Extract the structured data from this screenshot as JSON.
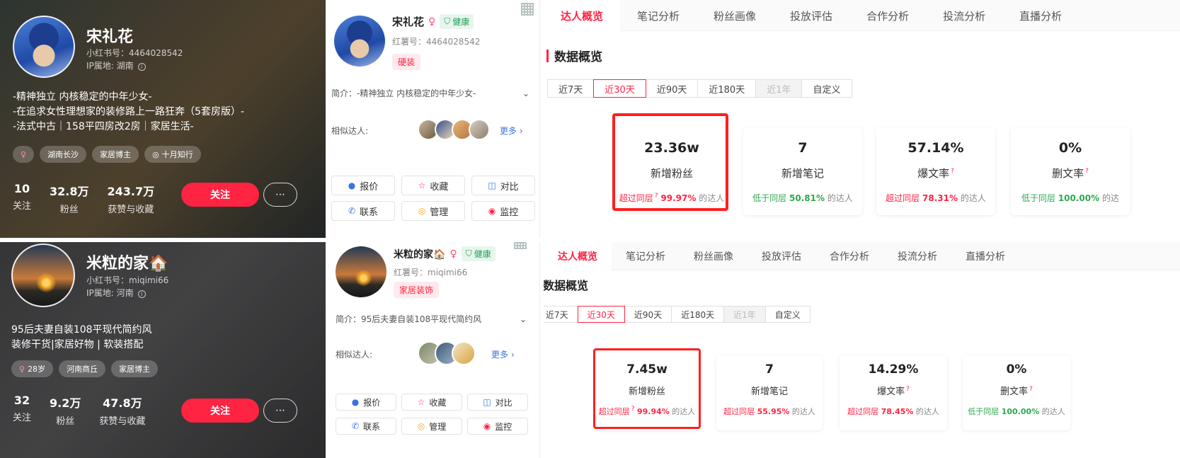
{
  "profiles": [
    {
      "name": "宋礼花",
      "xhs_id": "小红书号：4464028542",
      "ip": "IP属地: 湖南",
      "bio": [
        "-精神独立 内核稳定的中年少女-",
        "-在追求女性理想家的装修路上一路狂奔（5套房版）-",
        "-法式中古｜158平四房改2房｜家居生活-"
      ],
      "tags": [
        "湖南长沙",
        "家居博主",
        "十月知行"
      ],
      "stats": [
        {
          "value": "10",
          "label": "关注"
        },
        {
          "value": "32.8万",
          "label": "粉丝"
        },
        {
          "value": "243.7万",
          "label": "获赞与收藏"
        }
      ],
      "follow": "关注"
    },
    {
      "name": "米粒的家🏠",
      "xhs_id": "小红书号：miqimi66",
      "ip": "IP属地: 河南",
      "bio": [
        "95后夫妻自装108平现代简约风",
        "装修干货|家居好物 | 软装搭配"
      ],
      "tags": [
        "28岁",
        "河南商丘",
        "家居博主"
      ],
      "stats": [
        {
          "value": "32",
          "label": "关注"
        },
        {
          "value": "9.2万",
          "label": "粉丝"
        },
        {
          "value": "47.8万",
          "label": "获赞与收藏"
        }
      ],
      "follow": "关注"
    }
  ],
  "infos": [
    {
      "name": "宋礼花",
      "health": "健康",
      "rid": "红薯号：4464028542",
      "category": "硬装",
      "intro": "简介：-精神独立 内核稳定的中年少女-",
      "similar": "相似达人:",
      "more": "更多",
      "buttons": [
        "报价",
        "收藏",
        "对比",
        "联系",
        "管理",
        "监控"
      ]
    },
    {
      "name": "米粒的家🏠",
      "health": "健康",
      "rid": "红薯号：miqimi66",
      "category": "家居装饰",
      "intro": "简介：95后夫妻自装108平现代简约风",
      "similar": "相似达人:",
      "more": "更多",
      "buttons": [
        "报价",
        "收藏",
        "对比",
        "联系",
        "管理",
        "监控"
      ]
    }
  ],
  "tabs": [
    "达人概览",
    "笔记分析",
    "粉丝画像",
    "投放评估",
    "合作分析",
    "投流分析",
    "直播分析"
  ],
  "section_title": "数据概览",
  "ranges": [
    "近7天",
    "近30天",
    "近90天",
    "近180天",
    "近1年",
    "自定义"
  ],
  "analytics": [
    {
      "cards": [
        {
          "value": "23.36w",
          "label": "新增粉丝",
          "cmp_pre": "超过同层",
          "pct": "99.97%",
          "cmp_post": "的达人",
          "dir": "up"
        },
        {
          "value": "7",
          "label": "新增笔记",
          "cmp_pre": "低于同层",
          "pct": "50.81%",
          "cmp_post": "的达人",
          "dir": "down"
        },
        {
          "value": "57.14%",
          "label": "爆文率",
          "cmp_pre": "超过同层",
          "pct": "78.31%",
          "cmp_post": "的达人",
          "dir": "up"
        },
        {
          "value": "0%",
          "label": "删文率",
          "cmp_pre": "低于同层",
          "pct": "100.00%",
          "cmp_post": "的达",
          "dir": "down"
        }
      ]
    },
    {
      "cards": [
        {
          "value": "7.45w",
          "label": "新增粉丝",
          "cmp_pre": "超过同层",
          "pct": "99.94%",
          "cmp_post": "的达人",
          "dir": "up"
        },
        {
          "value": "7",
          "label": "新增笔记",
          "cmp_pre": "超过同层",
          "pct": "55.95%",
          "cmp_post": "的达人",
          "dir": "up"
        },
        {
          "value": "14.29%",
          "label": "爆文率",
          "cmp_pre": "超过同层",
          "pct": "78.45%",
          "cmp_post": "的达人",
          "dir": "up"
        },
        {
          "value": "0%",
          "label": "删文率",
          "cmp_pre": "低于同层",
          "pct": "100.00%",
          "cmp_post": "的达人",
          "dir": "down"
        }
      ]
    }
  ],
  "selected_range": "近30天",
  "disabled_range": "近1年",
  "colors": {
    "accent": "#ff2442",
    "positive": "#2fa84f",
    "highlight_box": "#ff1f1f"
  }
}
